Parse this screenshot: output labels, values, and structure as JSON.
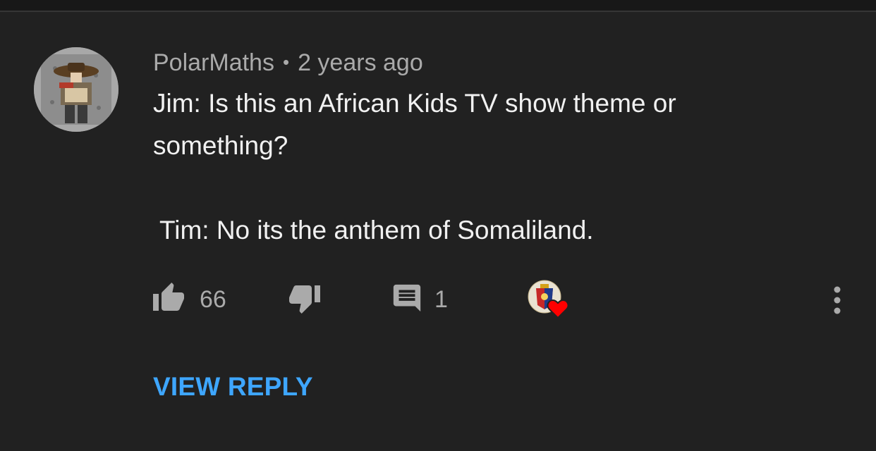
{
  "comment": {
    "author": "PolarMaths",
    "separator": "•",
    "timestamp": "2 years ago",
    "text_line1": "Jim: Is this an African Kids TV show theme or",
    "text_line2": "something?",
    "text_line3": "Tim: No its the anthem of Somaliland.",
    "like_count": "66",
    "reply_count": "1",
    "view_reply_label": "VIEW REPLY"
  },
  "icons": {
    "like": "thumbs-up-icon",
    "dislike": "thumbs-down-icon",
    "reply": "comment-icon",
    "creator_heart": "creator-heart-icon",
    "more": "more-vertical-icon"
  },
  "colors": {
    "background": "#212121",
    "secondary_text": "#aaaaaa",
    "primary_text": "#f1f1f1",
    "link": "#3ea6ff",
    "heart": "#ff0000"
  }
}
